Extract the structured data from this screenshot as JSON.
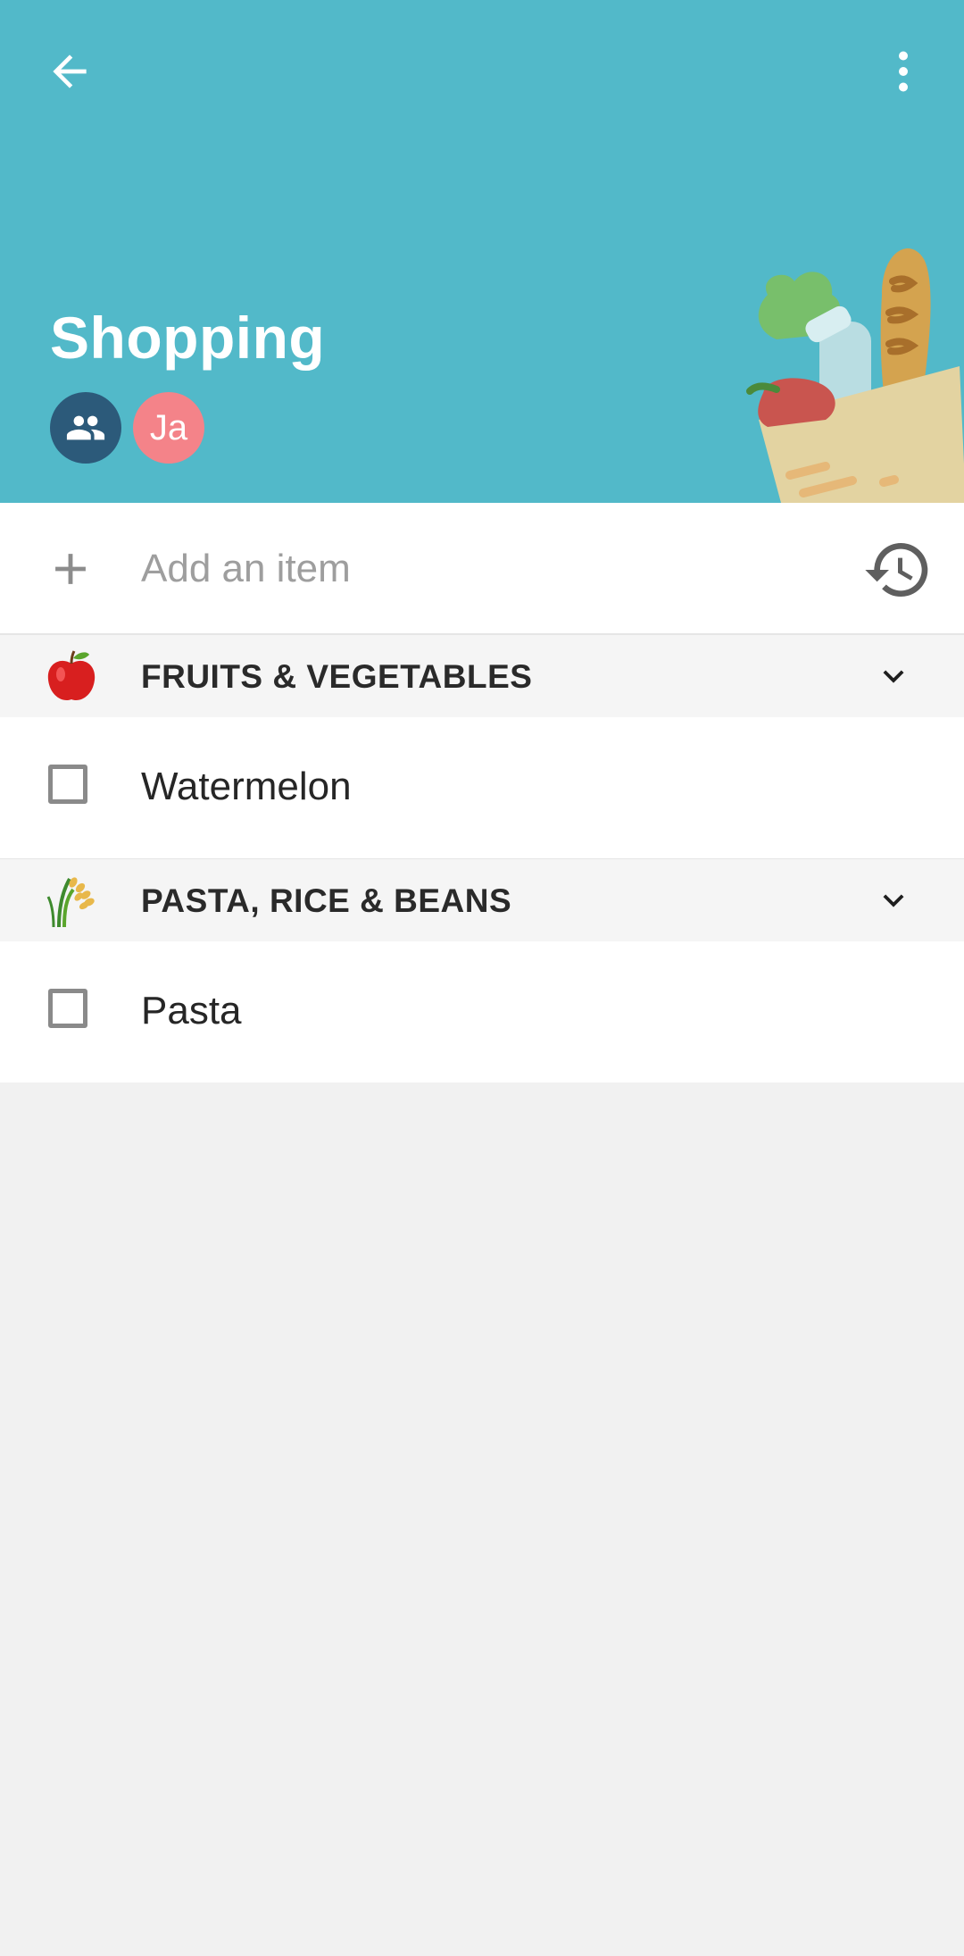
{
  "app": {
    "list_title": "Shopping",
    "header_color": "#52b9c9"
  },
  "header": {
    "back_icon": "arrow-left-icon",
    "more_icon": "more-vertical-icon",
    "members": [
      {
        "type": "group",
        "icon": "people-icon",
        "color": "#2c5a7a"
      },
      {
        "type": "user",
        "initials": "Ja",
        "color": "#f48389"
      }
    ]
  },
  "add_item": {
    "placeholder": "Add an item",
    "plus_icon": "plus-icon",
    "history_icon": "history-icon"
  },
  "categories": [
    {
      "label": "FRUITS & VEGETABLES",
      "emoji_icon": "apple-icon",
      "items": [
        {
          "label": "Watermelon",
          "checked": false
        }
      ]
    },
    {
      "label": "PASTA, RICE & BEANS",
      "emoji_icon": "rice-plant-icon",
      "items": [
        {
          "label": "Pasta",
          "checked": false
        }
      ]
    }
  ]
}
